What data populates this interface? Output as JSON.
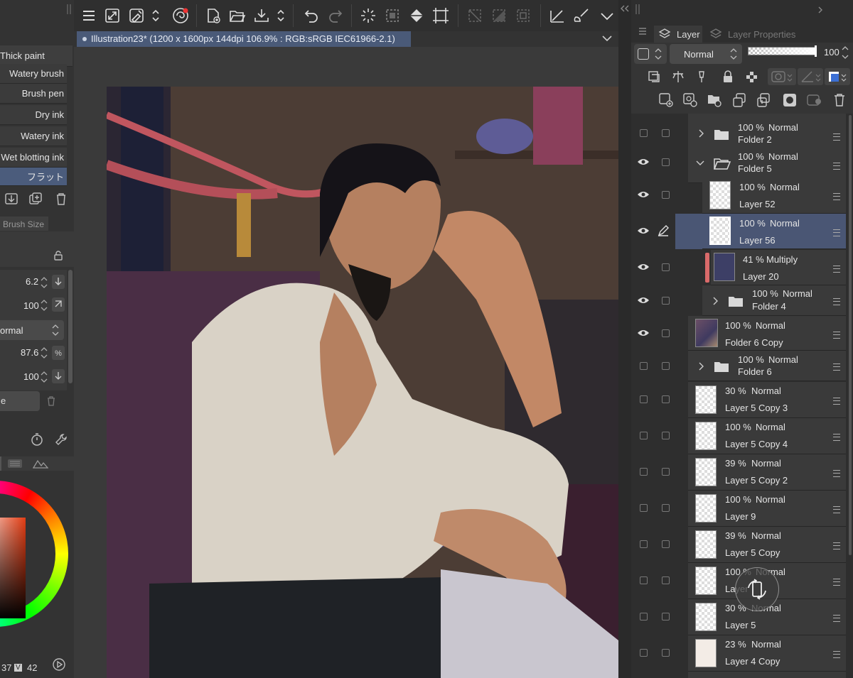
{
  "document": {
    "tab_title": "Illustration23* (1200 x 1600px 144dpi 106.9% : RGB:sRGB IEC61966-2.1)"
  },
  "brush_list": [
    {
      "label": "Thick paint"
    },
    {
      "label": "Watery brush"
    },
    {
      "label": "Brush pen"
    },
    {
      "label": "Dry ink"
    },
    {
      "label": "Watery ink"
    },
    {
      "label": "Wet blotting ink"
    },
    {
      "label": "フラット",
      "selected": true
    }
  ],
  "tool_property": {
    "tab_label": "Brush Size",
    "brush_size": "6.2",
    "opacity": "100",
    "blend_mode": "ormal",
    "value_a": "87.6",
    "value_b": "100",
    "button_partial": "e"
  },
  "color": {
    "readout_left": "37",
    "readout_v_label": "V",
    "readout_right": "42"
  },
  "layer_panel": {
    "tab_layer": "Layer",
    "tab_properties": "Layer Properties",
    "blend_mode": "Normal",
    "opacity": "100",
    "layers": [
      {
        "percent": "100 %",
        "mode": "Normal",
        "name": "Folder 2",
        "type": "folder",
        "expanded": false,
        "visible": false
      },
      {
        "percent": "100 %",
        "mode": "Normal",
        "name": "Folder 5",
        "type": "folder",
        "expanded": true,
        "visible": true
      },
      {
        "percent": "100 %",
        "mode": "Normal",
        "name": "Layer 52",
        "type": "raster",
        "visible": true
      },
      {
        "percent": "100 %",
        "mode": "Normal",
        "name": "Layer 56",
        "type": "raster",
        "visible": true,
        "selected": true
      },
      {
        "percent": "41 %",
        "mode": "Multiply",
        "name": "Layer 20",
        "type": "raster",
        "visible": true
      },
      {
        "percent": "100 %",
        "mode": "Normal",
        "name": "Folder 4",
        "type": "folder",
        "expanded": false,
        "visible": true
      },
      {
        "percent": "100 %",
        "mode": "Normal",
        "name": "Folder 6 Copy",
        "type": "raster",
        "visible": true
      },
      {
        "percent": "100 %",
        "mode": "Normal",
        "name": "Folder 6",
        "type": "folder",
        "expanded": false,
        "visible": false
      },
      {
        "percent": "30 %",
        "mode": "Normal",
        "name": "Layer 5 Copy 3",
        "type": "raster",
        "visible": false
      },
      {
        "percent": "100 %",
        "mode": "Normal",
        "name": "Layer 5 Copy 4",
        "type": "raster",
        "visible": false
      },
      {
        "percent": "39 %",
        "mode": "Normal",
        "name": "Layer 5 Copy 2",
        "type": "raster",
        "visible": false
      },
      {
        "percent": "100 %",
        "mode": "Normal",
        "name": "Layer 9",
        "type": "raster",
        "visible": false
      },
      {
        "percent": "39 %",
        "mode": "Normal",
        "name": "Layer 5 Copy",
        "type": "raster",
        "visible": false
      },
      {
        "percent": "100 %",
        "mode": "Normal",
        "name": "Layer",
        "type": "raster",
        "visible": false
      },
      {
        "percent": "30 %",
        "mode": "Normal",
        "name": "Layer 5",
        "type": "raster",
        "visible": false
      },
      {
        "percent": "23 %",
        "mode": "Normal",
        "name": "Layer 4 Copy",
        "type": "raster",
        "visible": false
      }
    ]
  },
  "colors": {
    "selected_row": "#4a5674",
    "doc_tab": "#4a5a78",
    "panel_bg": "#2e2e2e"
  }
}
